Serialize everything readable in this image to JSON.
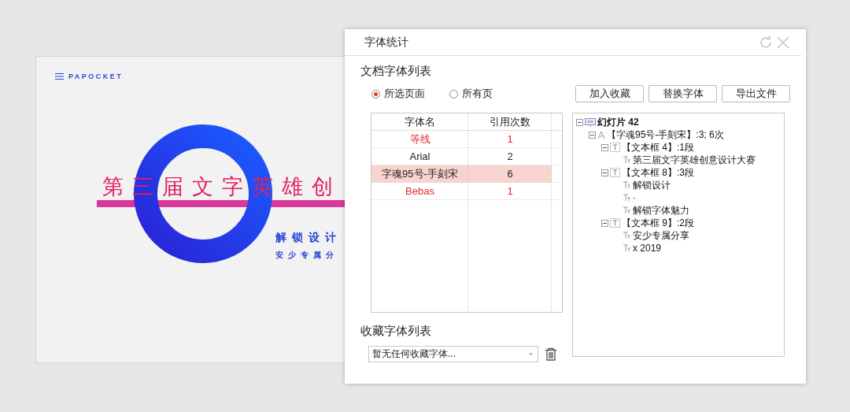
{
  "slide": {
    "brand": "PAPOCKET",
    "title": "第三届文字英雄创",
    "subtitle": "解锁设计",
    "tagline": "安少专属分"
  },
  "dialog": {
    "title": "字体统计",
    "doc_fonts": {
      "heading": "文档字体列表",
      "scope": [
        {
          "label": "所选页面",
          "selected": true
        },
        {
          "label": "所有页",
          "selected": false
        }
      ],
      "buttons": [
        "加入收藏",
        "替换字体",
        "导出文件"
      ],
      "table": {
        "columns": [
          "字体名",
          "引用次数"
        ],
        "rows": [
          {
            "name": "等线",
            "count": "1",
            "missing": true,
            "selected": false
          },
          {
            "name": "Arial",
            "count": "2",
            "missing": false,
            "selected": false
          },
          {
            "name": "字魂95号-手刻宋",
            "count": "6",
            "missing": false,
            "selected": true
          },
          {
            "name": "Bebas",
            "count": "1",
            "missing": true,
            "selected": false
          }
        ]
      },
      "tree": [
        {
          "kind": "slide",
          "label": "幻灯片 42",
          "expanded": true,
          "children": [
            {
              "kind": "font",
              "label": "【字魂95号-手刻宋】:3; 6次",
              "expanded": true,
              "children": [
                {
                  "kind": "textbox",
                  "label": "【文本框 4】:1段",
                  "expanded": true,
                  "children": [
                    {
                      "kind": "paragraph",
                      "label": "第三届文字英雄创意设计大赛"
                    }
                  ]
                },
                {
                  "kind": "textbox",
                  "label": "【文本框 8】:3段",
                  "expanded": true,
                  "children": [
                    {
                      "kind": "paragraph",
                      "label": "解锁设计"
                    },
                    {
                      "kind": "paragraph",
                      "label": "·"
                    },
                    {
                      "kind": "paragraph",
                      "label": "解锁字体魅力"
                    }
                  ]
                },
                {
                  "kind": "textbox",
                  "label": "【文本框 9】:2段",
                  "expanded": true,
                  "children": [
                    {
                      "kind": "paragraph",
                      "label": "安少专属分享"
                    },
                    {
                      "kind": "paragraph",
                      "label": "x 2019"
                    }
                  ]
                }
              ]
            }
          ]
        }
      ]
    },
    "favorites": {
      "heading": "收藏字体列表",
      "value": "暂无任何收藏字体..."
    }
  }
}
